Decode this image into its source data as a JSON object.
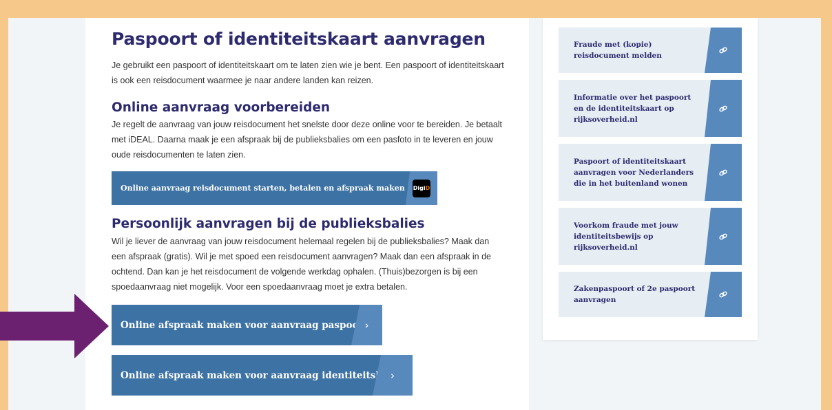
{
  "colors": {
    "border": "#f6c98a",
    "heading": "#2d2a6e",
    "button": "#3d72a4",
    "button_accent": "#5889bd",
    "link_card_bg": "#e6edf3",
    "pointer_arrow": "#6b2170"
  },
  "main": {
    "title": "Paspoort of identiteitskaart aanvragen",
    "intro": "Je gebruikt een paspoort of identiteitskaart om te laten zien wie je bent. Een paspoort of identiteitskaart is ook een reisdocument waarmee je naar andere landen kan reizen.",
    "online": {
      "heading": "Online aanvraag voorbereiden",
      "text": "Je regelt de aanvraag van jouw reisdocument het snelste door deze online voor te bereiden. Je betaalt met iDEAL. Daarna maak je een afspraak bij de publieksbalies om een pasfoto in te leveren en jouw oude reisdocumenten te laten zien.",
      "button_label": "Online aanvraag reisdocument starten, betalen en afspraak maken (DigiD)",
      "digid_logo": {
        "part1": "Digi",
        "part2": "D"
      }
    },
    "personal": {
      "heading": "Persoonlijk aanvragen bij de publieksbalies",
      "text": "Wil je liever de aanvraag van jouw reisdocument helemaal regelen bij de publieksbalies? Maak dan een afspraak (gratis). Wil je met spoed een reisdocument aanvragen? Maak dan een afspraak in de ochtend. Dan kan je het reisdocument de volgende werkdag ophalen. (Thuis)bezorgen is bij een spoedaanvraag niet mogelijk. Voor een spoedaanvraag moet je extra betalen.",
      "button_passport": "Online afspraak maken voor aanvraag paspoort",
      "button_idcard": "Online afspraak maken voor aanvraag identiteitskaart",
      "chevron": "›"
    }
  },
  "sidebar": {
    "links": [
      {
        "label": "Fraude met (kopie) reisdocument melden",
        "icon": "link-icon"
      },
      {
        "label": "Informatie over het paspoort en de identiteitskaart op rijksoverheid.nl",
        "icon": "link-icon"
      },
      {
        "label": "Paspoort of identiteitskaart aanvragen voor Nederlanders die in het buitenland wonen",
        "icon": "link-icon"
      },
      {
        "label": "Voorkom fraude met jouw identiteitsbewijs op rijksoverheid.nl",
        "icon": "link-icon"
      },
      {
        "label": "Zakenpaspoort of 2e paspoort aanvragen",
        "icon": "link-icon"
      }
    ]
  }
}
